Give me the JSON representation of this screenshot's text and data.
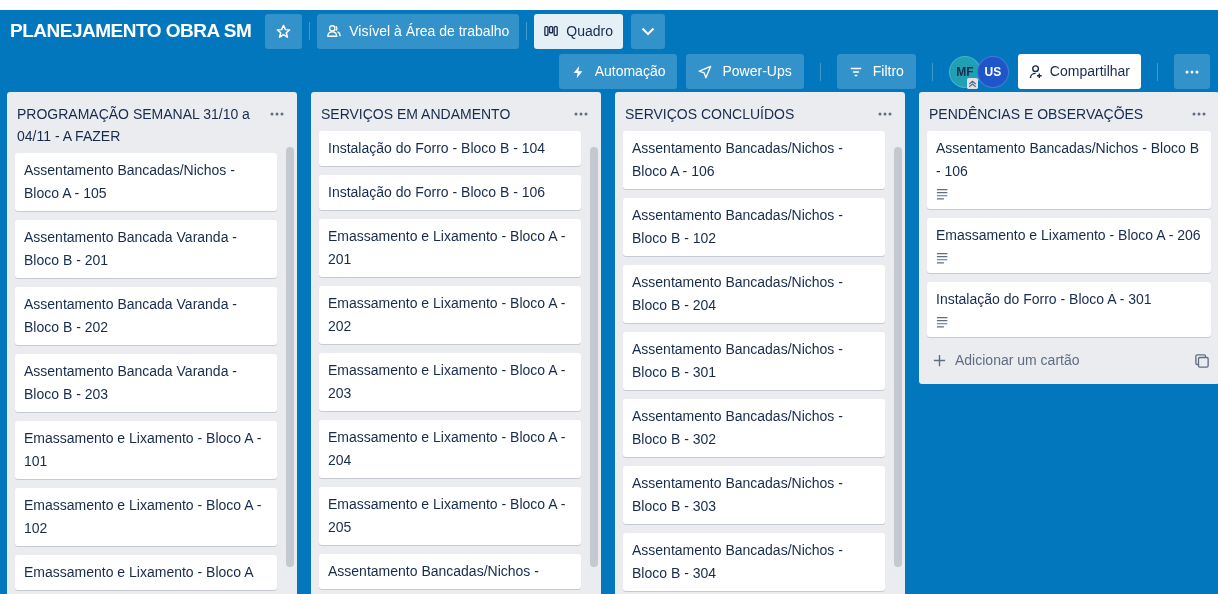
{
  "board": {
    "title": "PLANEJAMENTO OBRA SM",
    "starred": false
  },
  "header_buttons": [
    {
      "kind": "visibility",
      "label": "Visível à Área de trabalho"
    },
    {
      "kind": "view",
      "label": "Quadro",
      "selected": true
    },
    {
      "kind": "chevron"
    }
  ],
  "toolbar": [
    {
      "kind": "automation",
      "label": "Automação"
    },
    {
      "kind": "powerups",
      "label": "Power-Ups"
    },
    {
      "kind": "filter",
      "label": "Filtro"
    }
  ],
  "members": [
    {
      "initials": "MF",
      "color": "#1ea0b5",
      "admin": true
    },
    {
      "initials": "US",
      "color": "#1e55c8",
      "admin": false
    }
  ],
  "share_button": "Compartilhar",
  "lists": [
    {
      "title": "PROGRAMAÇÃO SEMANAL 31/10 a 04/11 - A FAZER",
      "cards": [
        {
          "title": "Assentamento Bancadas/Nichos - Bloco A - 105",
          "description": false
        },
        {
          "title": "Assentamento Bancada Varanda - Bloco B - 201",
          "description": false
        },
        {
          "title": "Assentamento Bancada Varanda - Bloco B - 202",
          "description": false
        },
        {
          "title": "Assentamento Bancada Varanda - Bloco B - 203",
          "description": false
        },
        {
          "title": "Emassamento e Lixamento - Bloco A - 101",
          "description": false
        },
        {
          "title": "Emassamento e Lixamento - Bloco A - 102",
          "description": false
        },
        {
          "title": "Emassamento e Lixamento - Bloco A",
          "description": false
        }
      ]
    },
    {
      "title": "SERVIÇOS EM ANDAMENTO",
      "cards": [
        {
          "title": "Instalação do Forro - Bloco B - 104",
          "description": false
        },
        {
          "title": "Instalação do Forro - Bloco B - 106",
          "description": false
        },
        {
          "title": "Emassamento e Lixamento - Bloco A - 201",
          "description": false
        },
        {
          "title": "Emassamento e Lixamento - Bloco A - 202",
          "description": false
        },
        {
          "title": "Emassamento e Lixamento - Bloco A - 203",
          "description": false
        },
        {
          "title": "Emassamento e Lixamento - Bloco A - 204",
          "description": false
        },
        {
          "title": "Emassamento e Lixamento - Bloco A - 205",
          "description": false
        },
        {
          "title": "Assentamento Bancadas/Nichos -",
          "description": false
        }
      ]
    },
    {
      "title": "SERVIÇOS CONCLUÍDOS",
      "cards": [
        {
          "title": "Assentamento Bancadas/Nichos - Bloco A - 106",
          "description": false
        },
        {
          "title": "Assentamento Bancadas/Nichos - Bloco B - 102",
          "description": false
        },
        {
          "title": "Assentamento Bancadas/Nichos - Bloco B - 204",
          "description": false
        },
        {
          "title": "Assentamento Bancadas/Nichos - Bloco B - 301",
          "description": false
        },
        {
          "title": "Assentamento Bancadas/Nichos - Bloco B - 302",
          "description": false
        },
        {
          "title": "Assentamento Bancadas/Nichos - Bloco B - 303",
          "description": false
        },
        {
          "title": "Assentamento Bancadas/Nichos - Bloco B - 304",
          "description": false
        }
      ]
    },
    {
      "title": "PENDÊNCIAS E OBSERVAÇÕES",
      "add_card": "Adicionar um cartão",
      "cards": [
        {
          "title": "Assentamento Bancadas/Nichos - Bloco B - 106",
          "description": true
        },
        {
          "title": "Emassamento e Lixamento - Bloco A - 206",
          "description": true
        },
        {
          "title": "Instalação do Forro - Bloco A - 301",
          "description": true
        }
      ]
    }
  ]
}
